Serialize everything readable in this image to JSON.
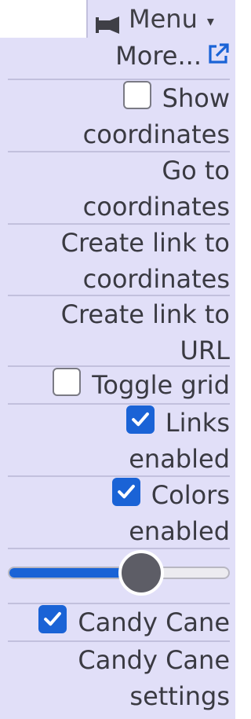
{
  "menu_button": {
    "label": "Menu",
    "icon": "pin-icon",
    "caret": "▾"
  },
  "menu": {
    "more_label": "More...",
    "more_icon": "external-link-icon",
    "show_coordinates": {
      "line1": "Show",
      "line2": "coordinates",
      "checked": false
    },
    "go_to_coordinates": {
      "line1": "Go to",
      "line2": "coordinates"
    },
    "create_link_coordinates": {
      "line1": "Create link to",
      "line2": "coordinates"
    },
    "create_link_url": {
      "line1": "Create link to",
      "line2": "URL"
    },
    "toggle_grid": {
      "label": "Toggle grid",
      "checked": false
    },
    "links_enabled": {
      "line1": "Links",
      "line2": "enabled",
      "checked": true
    },
    "colors_enabled": {
      "line1": "Colors",
      "line2": "enabled",
      "checked": true
    },
    "slider": {
      "value_fraction": 0.6
    },
    "candy_cane": {
      "label": "Candy Cane",
      "checked": true
    },
    "candy_cane_settings": {
      "line1": "Candy Cane",
      "line2": "settings"
    }
  },
  "colors": {
    "panel_bg": "#e1dff8",
    "divider": "#c2c0dd",
    "accent": "#1a63d6",
    "text": "#3a3a42"
  }
}
